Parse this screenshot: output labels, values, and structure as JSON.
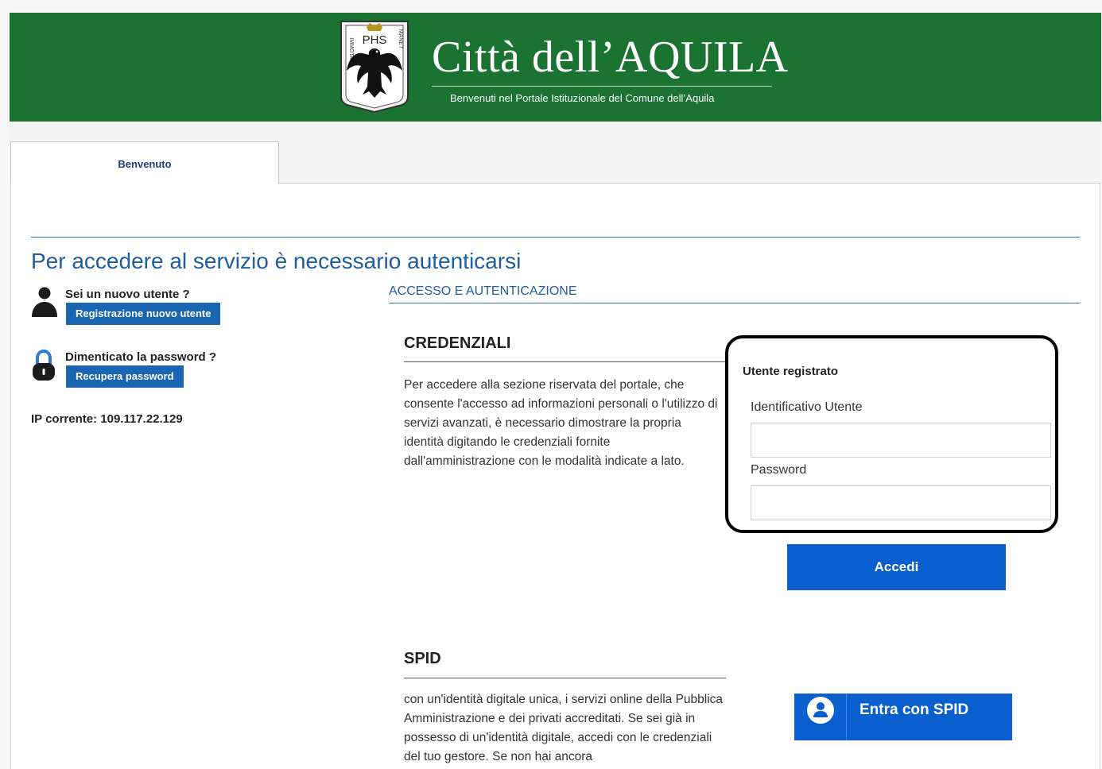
{
  "header": {
    "title": "Città dell’AQUILA",
    "subtitle": "Benvenuti nel Portale Istituzionale del Comune dell’Aquila",
    "crest": {
      "motto_left": "IMMOTA",
      "motto_center": "PHS",
      "motto_right": "MANET"
    }
  },
  "tabs": [
    {
      "label": "Benvenuto",
      "active": true
    }
  ],
  "page": {
    "title": "Per accedere al servizio è necessario autenticarsi"
  },
  "sidebar": {
    "new_user_question": "Sei un nuovo utente ?",
    "register_button": "Registrazione nuovo utente",
    "forgot_question": "Dimenticato la password ?",
    "recover_button": "Recupera password",
    "ip_label": "IP corrente: 109.117.22.129"
  },
  "main": {
    "section_label": "ACCESSO E AUTENTICAZIONE",
    "credentials": {
      "heading": "CREDENZIALI",
      "text": "Per accedere alla sezione riservata del portale, che consente l'accesso ad informazioni personali o l'utilizzo di servizi avanzati, è necessario dimostrare la propria identità digitando le credenziali fornite dall'amministrazione con le modalità indicate a lato."
    },
    "login": {
      "title": "Utente registrato",
      "user_label": "Identificativo Utente",
      "user_value": "",
      "password_label": "Password",
      "password_value": "",
      "submit_button": "Accedi"
    },
    "spid": {
      "heading": "SPID",
      "text": "con un'identità digitale unica, i servizi online della Pubblica Amministrazione e dei privati accreditati. Se sei già in possesso di un'identità digitale, accedi con le credenziali del tuo gestore. Se non hai ancora",
      "button": "Entra con SPID"
    }
  },
  "colors": {
    "header_green": "#1b7332",
    "primary_blue": "#0a5fcf",
    "link_blue": "#1f5e9c",
    "small_button_blue": "#1a65b2"
  },
  "icons": {
    "user": "user-icon",
    "lock": "lock-icon",
    "spid": "spid-user-icon",
    "crest": "city-crest-eagle"
  }
}
